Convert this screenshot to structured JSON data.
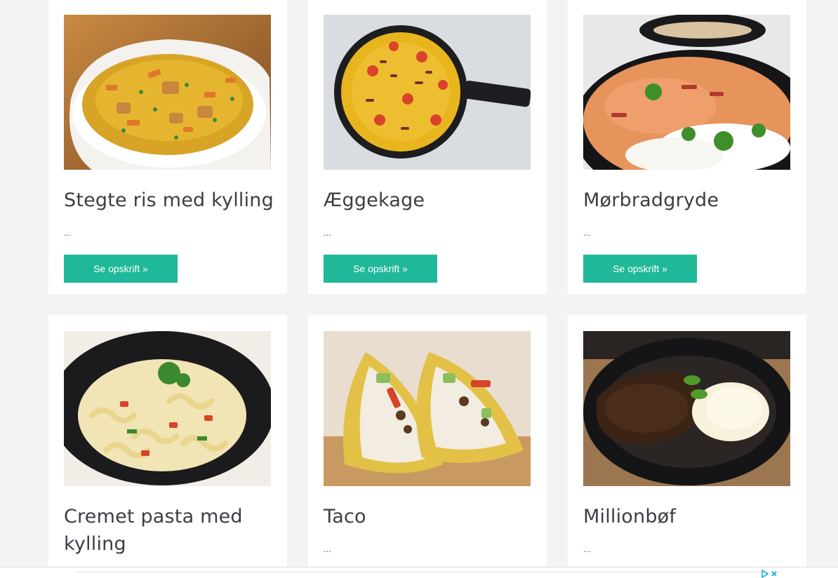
{
  "colors": {
    "accent_button": "#1fb899",
    "card_background": "#ffffff",
    "page_background": "#f3f3f3",
    "title_text": "#3a3f44"
  },
  "recipes": [
    {
      "title": "Stegte ris med kylling",
      "excerpt": "...",
      "button_label": "Se opskrift »",
      "image": "fried-rice-chicken-photo"
    },
    {
      "title": "Æggekage",
      "excerpt": "...",
      "button_label": "Se opskrift »",
      "image": "egg-pancake-pan-photo"
    },
    {
      "title": "Mørbradgryde",
      "excerpt": "...",
      "button_label": "Se opskrift »",
      "image": "pork-stew-rice-photo"
    },
    {
      "title": "Cremet pasta med kylling",
      "excerpt": "...",
      "image": "creamy-pasta-bowl-photo"
    },
    {
      "title": "Taco",
      "excerpt": "...",
      "image": "tacos-photo"
    },
    {
      "title": "Millionbøf",
      "excerpt": "...",
      "image": "millionbof-mash-photo"
    }
  ],
  "ad_bar": {
    "icon": "adchoices-icon"
  }
}
